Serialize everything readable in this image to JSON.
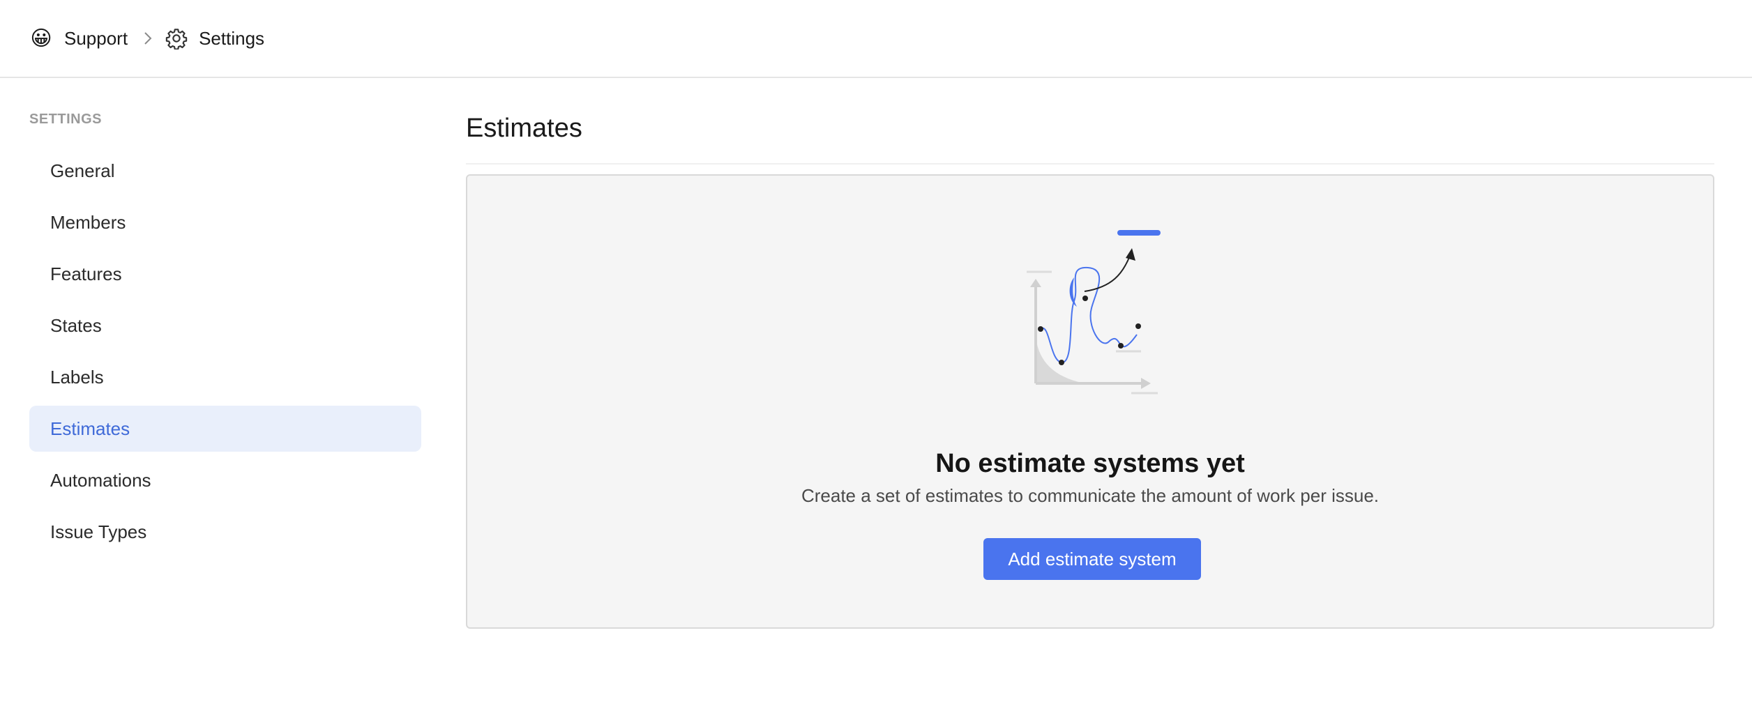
{
  "breadcrumb": {
    "project_emoji": "😀",
    "project_name": "Support",
    "page_name": "Settings"
  },
  "sidebar": {
    "heading": "SETTINGS",
    "items": [
      {
        "label": "General"
      },
      {
        "label": "Members"
      },
      {
        "label": "Features"
      },
      {
        "label": "States"
      },
      {
        "label": "Labels"
      },
      {
        "label": "Estimates",
        "active": true
      },
      {
        "label": "Automations"
      },
      {
        "label": "Issue Types"
      }
    ]
  },
  "main": {
    "title": "Estimates",
    "empty_state": {
      "illustration": "estimate-chart-illustration",
      "title": "No estimate systems yet",
      "description": "Create a set of estimates to communicate the amount of work per issue.",
      "button_label": "Add estimate system"
    }
  },
  "colors": {
    "accent": "#4a74ee",
    "active_bg": "#e9effb",
    "active_text": "#3f6ad8",
    "card_bg": "#f5f5f5"
  }
}
